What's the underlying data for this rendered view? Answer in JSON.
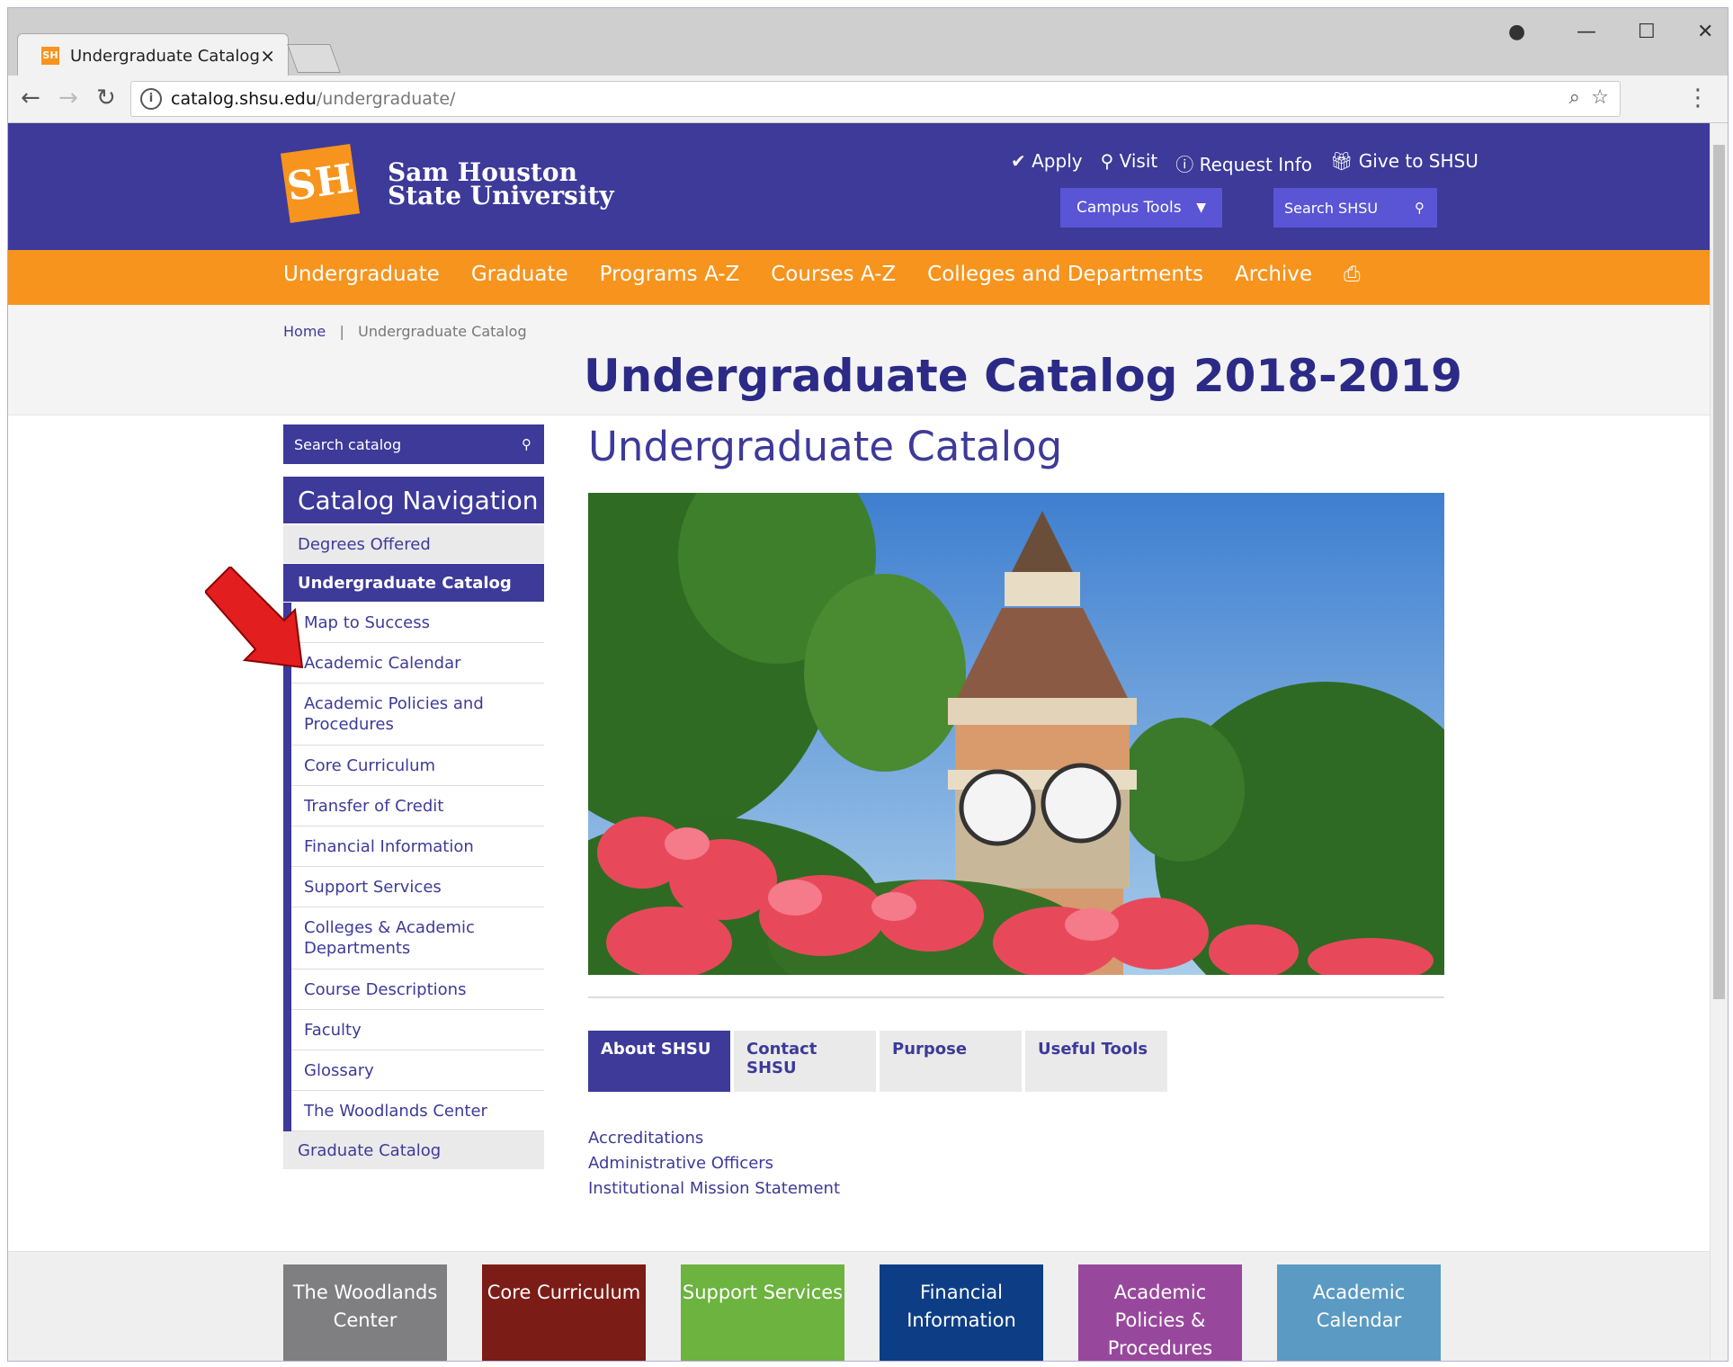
{
  "browser": {
    "tab_title": "Undergraduate Catalog",
    "url_host": "catalog.shsu.edu",
    "url_path": "/undergraduate/"
  },
  "header": {
    "logo_monogram": "SH",
    "logo_line1": "Sam Houston",
    "logo_line2": "State University",
    "links": [
      "Apply",
      "Visit",
      "Request Info",
      "Give to SHSU"
    ],
    "campus_tools": "Campus Tools",
    "search_placeholder": "Search SHSU"
  },
  "mainnav": [
    "Undergraduate",
    "Graduate",
    "Programs A-Z",
    "Courses A-Z",
    "Colleges and Departments",
    "Archive"
  ],
  "breadcrumb": {
    "home": "Home",
    "current": "Undergraduate Catalog"
  },
  "page_title": "Undergraduate Catalog 2018-2019",
  "sidebar": {
    "search_placeholder": "Search catalog",
    "nav_title": "Catalog Navigation",
    "degrees": "Degrees Offered",
    "active": "Undergraduate Catalog",
    "subitems": [
      "Map to Success",
      "Academic Calendar",
      "Academic Policies and Procedures",
      "Core Curriculum",
      "Transfer of Credit",
      "Financial Information",
      "Support Services",
      "Colleges & Academic Departments",
      "Course Descriptions",
      "Faculty",
      "Glossary",
      "The Woodlands Center"
    ],
    "graduate": "Graduate Catalog"
  },
  "main": {
    "title": "Undergraduate Catalog",
    "tabs": [
      "About SHSU",
      "Contact SHSU",
      "Purpose",
      "Useful Tools"
    ],
    "links": [
      "Accreditations",
      "Administrative Officers",
      "Institutional Mission Statement"
    ]
  },
  "tiles": [
    {
      "label": "The Woodlands Center",
      "color": "#7f7f82"
    },
    {
      "label": "Core Curriculum",
      "color": "#7c1c17"
    },
    {
      "label": "Support Services",
      "color": "#6db33f"
    },
    {
      "label": "Financial Information",
      "color": "#0d3e85"
    },
    {
      "label": "Academic Policies & Procedures",
      "color": "#98489c"
    },
    {
      "label": "Academic Calendar",
      "color": "#5b9ac2"
    }
  ],
  "colors": {
    "brand_purple": "#3d3a99",
    "brand_orange": "#f7941d",
    "annotation_arrow": "#e31e1e"
  }
}
